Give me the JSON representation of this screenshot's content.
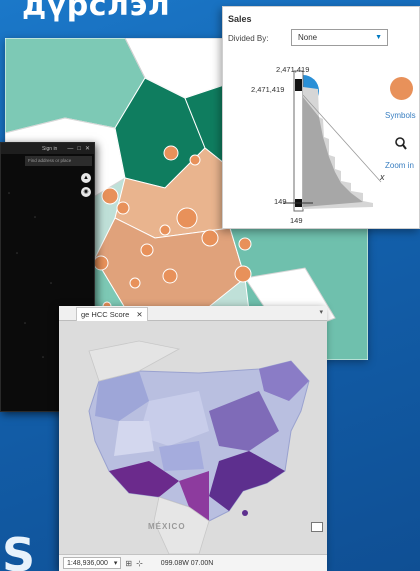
{
  "slide": {
    "heading": "дүрслэл",
    "bottom_letter": "S"
  },
  "dark_window": {
    "signin": "Sign in",
    "controls": [
      "—",
      "□",
      "✕"
    ],
    "search_placeholder": "Find address or place",
    "logo": "esri"
  },
  "us_map_window": {
    "tab_label": "ge HCC Score",
    "tab_close": "✕",
    "place_label": "MÉXICO",
    "scale": "1:48,936,000",
    "coordinates": "099.08W 07.00N"
  },
  "sales_panel": {
    "title": "Sales",
    "divided_by_label": "Divided By:",
    "divided_by_value": "None",
    "max_top": "2,471,419",
    "max_side": "2,471,419",
    "min_side": "149",
    "min_bottom": "149",
    "x_marker": "x",
    "symbols_label": "Symbols",
    "zoom_label": "Zoom in",
    "symbol_color": "#e8915a",
    "accent": "#2a8fd6"
  },
  "colors": {
    "teal": "#6fc0ad",
    "dark_green": "#0f7d5f",
    "orange": "#e8915a",
    "purple": "#6b2a8c"
  }
}
